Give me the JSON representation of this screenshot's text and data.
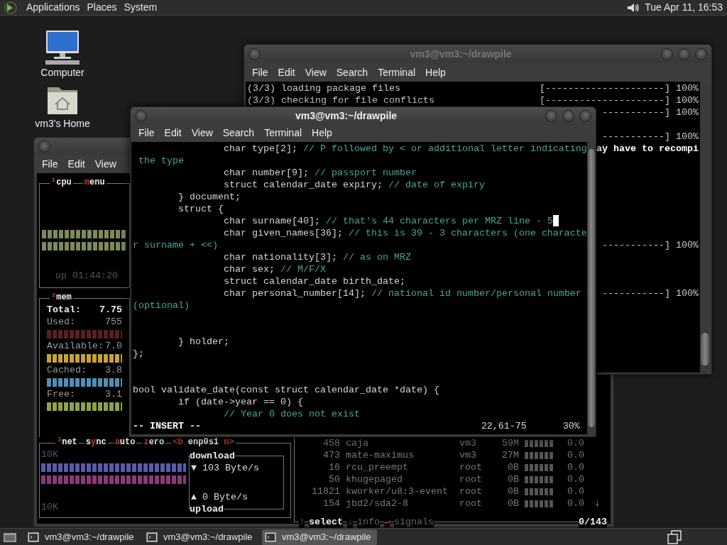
{
  "top_panel": {
    "menus": [
      "Applications",
      "Places",
      "System"
    ],
    "clock": "Tue Apr 11, 16:53"
  },
  "desktop_icons": [
    {
      "label": "Computer",
      "kind": "computer"
    },
    {
      "label": "vm3's Home",
      "kind": "home"
    }
  ],
  "monitor_window": {
    "menus": [
      "File",
      "Edit",
      "View"
    ],
    "cpu_box": {
      "headers": [
        {
          "parts": [
            {
              "t": "¹",
              "hot": true
            },
            {
              "t": "cpu",
              "hot": false
            }
          ]
        },
        {
          "parts": [
            {
              "t": "m",
              "hot": true
            },
            {
              "t": "enu",
              "hot": false
            }
          ]
        }
      ],
      "uptime": "up 01:44:20"
    },
    "mem_box": {
      "headers": [
        {
          "parts": [
            {
              "t": "²",
              "hot": true
            },
            {
              "t": "mem",
              "hot": false
            }
          ]
        }
      ],
      "rows": [
        {
          "kind": "total",
          "label": "Total:",
          "value": "7.75"
        },
        {
          "kind": "meter",
          "label": "Used:",
          "value": "755",
          "color": "#5a2020"
        },
        {
          "kind": "meter",
          "label": "Available:",
          "value": "7.0",
          "color": "#c9a13a"
        },
        {
          "kind": "meter",
          "label": "Cached:",
          "value": "3.8",
          "color": "#4f8fb8"
        },
        {
          "kind": "meter",
          "label": "Free:",
          "value": "3.1",
          "color": "#8ea34a"
        }
      ]
    },
    "net_box": {
      "headers": [
        {
          "parts": [
            {
              "t": "³",
              "hot": true
            },
            {
              "t": "net",
              "hot": false
            }
          ]
        },
        {
          "parts": [
            {
              "t": "s",
              "hot": false
            },
            {
              "t": "y",
              "hot": true
            },
            {
              "t": "nc",
              "hot": false
            }
          ]
        },
        {
          "parts": [
            {
              "t": "a",
              "hot": true
            },
            {
              "t": "uto",
              "hot": false
            }
          ]
        },
        {
          "parts": [
            {
              "t": "z",
              "hot": true
            },
            {
              "t": "ero",
              "hot": false
            }
          ]
        },
        {
          "parts": [
            {
              "t": "<b",
              "hot": true
            },
            {
              "t": " enp0s1 ",
              "hot": false
            },
            {
              "t": "n>",
              "hot": true
            }
          ]
        }
      ],
      "scale_top": "10K",
      "scale_bottom": "10K",
      "download": {
        "title": "download",
        "arrow": "▼",
        "rate": "103 Byte/s"
      },
      "upload": {
        "title": "upload",
        "arrow": "▲",
        "rate": "0 Byte/s"
      }
    },
    "processes": {
      "rows": [
        {
          "pid": "458",
          "name": "caja",
          "user": "vm3",
          "mem": "59M",
          "cpu": "0.0"
        },
        {
          "pid": "473",
          "name": "mate-maximus",
          "user": "vm3",
          "mem": "27M",
          "cpu": "0.0"
        },
        {
          "pid": "16",
          "name": "rcu_preempt",
          "user": "root",
          "mem": "0B",
          "cpu": "0.0"
        },
        {
          "pid": "50",
          "name": "khugepaged",
          "user": "root",
          "mem": "0B",
          "cpu": "0.0"
        },
        {
          "pid": "11821",
          "name": "kworker/u8:3-event",
          "user": "root",
          "mem": "0B",
          "cpu": "0.0"
        },
        {
          "pid": "154",
          "name": "jbd2/sda2-8",
          "user": "root",
          "mem": "0B",
          "cpu": "0.0"
        }
      ],
      "scroll_mark": "↓",
      "footer": [
        {
          "text": "↑",
          "kind": "dim"
        },
        {
          "text": "select",
          "kind": "bold"
        },
        {
          "text": "↓",
          "kind": "hot"
        },
        {
          "text": "info",
          "kind": "dim"
        },
        {
          "text": "↵",
          "kind": "hot"
        },
        {
          "text": "signals",
          "kind": "dim"
        },
        {
          "text": "0/143",
          "kind": "bold"
        }
      ]
    }
  },
  "package_window": {
    "title": "vm3@vm3:~/drawpile",
    "active": false,
    "menus": [
      "File",
      "Edit",
      "View",
      "Search",
      "Terminal",
      "Help"
    ],
    "lines": [
      {
        "kind": "progress",
        "left": "(3/3) loading package files",
        "right": "[---------------------] 100%"
      },
      {
        "kind": "progress",
        "left": "(3/3) checking for file conflicts",
        "right": "[---------------------] 100%"
      },
      {
        "kind": "progress",
        "right": "-----------] 100%"
      },
      {
        "kind": "blank"
      },
      {
        "kind": "progress",
        "right": "-----------] 100%"
      },
      {
        "kind": "message",
        "right": "ay have to recompi"
      },
      {
        "kind": "blank"
      },
      {
        "kind": "blank"
      },
      {
        "kind": "blank"
      },
      {
        "kind": "blank"
      },
      {
        "kind": "blank"
      },
      {
        "kind": "blank"
      },
      {
        "kind": "blank"
      },
      {
        "kind": "progress",
        "right": "-----------] 100%"
      },
      {
        "kind": "blank"
      },
      {
        "kind": "blank"
      },
      {
        "kind": "blank"
      },
      {
        "kind": "progress",
        "right": "-----------] 100%"
      }
    ]
  },
  "editor_window": {
    "title": "vm3@vm3:~/drawpile",
    "active": true,
    "menus": [
      "File",
      "Edit",
      "View",
      "Search",
      "Terminal",
      "Help"
    ],
    "lines": [
      {
        "code": "                char type[2]; ",
        "comment": "// P followed by < or additional letter indicating"
      },
      {
        "comment": " the type"
      },
      {
        "code": "                char number[9]; ",
        "comment": "// passport number"
      },
      {
        "code": "                struct calendar_date expiry; ",
        "comment": "// date of expiry"
      },
      {
        "code": "        } document;"
      },
      {
        "code": "        struct {"
      },
      {
        "code": "                char surname[40]; ",
        "comment": "// that's 44 characters per MRZ line - 5",
        "cursor": true
      },
      {
        "code": "                char given_names[36]; ",
        "comment": "// this is 39 - 3 characters (one characte"
      },
      {
        "comment": "r surname + <<)"
      },
      {
        "code": "                char nationality[3]; ",
        "comment": "// as on MRZ"
      },
      {
        "code": "                char sex; ",
        "comment": "// M/F/X"
      },
      {
        "code": "                struct calendar_date birth_date;"
      },
      {
        "code": "                char personal_number[14]; ",
        "comment": "// national id number/personal number"
      },
      {
        "comment": "(optional)"
      },
      {
        "code": "        } holder;",
        "gap_before": true
      },
      {
        "code": "};"
      },
      {
        "code": "bool validate_date(const struct calendar_date *date) {",
        "gap_before": true
      },
      {
        "code": "        if (date->year == 0) {"
      },
      {
        "comment": "                // Year 0 does not exist"
      }
    ],
    "mode": "-- INSERT --",
    "position": "22,61-75",
    "percent": "30%"
  },
  "taskbar": {
    "tasks": [
      {
        "label": "vm3@vm3:~/drawpile",
        "selected": false
      },
      {
        "label": "vm3@vm3:~/drawpile",
        "selected": false
      },
      {
        "label": "vm3@vm3:~/drawpile",
        "selected": true
      }
    ]
  }
}
